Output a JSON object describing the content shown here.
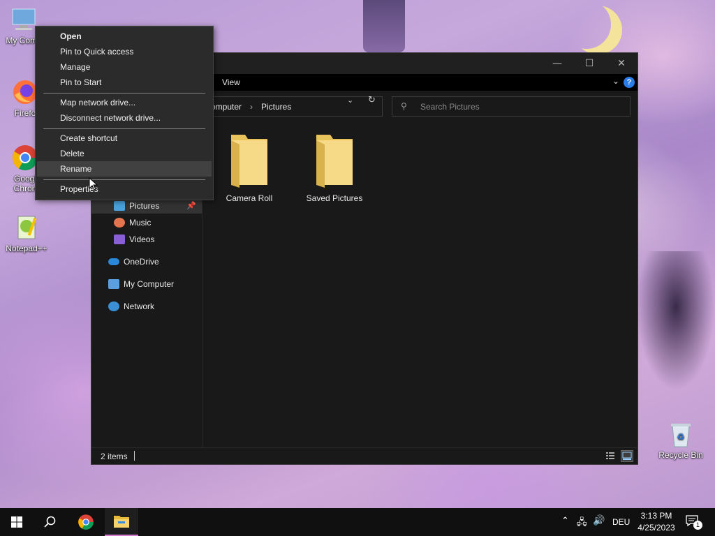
{
  "desktop": {
    "icons": [
      {
        "label": "My Comp",
        "icon": "computer-icon"
      },
      {
        "label": "Firefo",
        "icon": "firefox-icon"
      },
      {
        "label": "Googl\nChron",
        "label_line1": "Googl",
        "label_line2": "Chron",
        "icon": "chrome-icon"
      },
      {
        "label": "Notepad++",
        "icon": "notepadpp-icon"
      },
      {
        "label": "Recycle Bin",
        "icon": "recycle-bin-icon"
      }
    ]
  },
  "context_menu": {
    "items": [
      {
        "label": "Open",
        "bold": true
      },
      {
        "label": "Pin to Quick access"
      },
      {
        "label": "Manage"
      },
      {
        "label": "Pin to Start"
      },
      {
        "label": "Map network drive..."
      },
      {
        "label": "Disconnect network drive..."
      },
      {
        "label": "Create shortcut"
      },
      {
        "label": "Delete"
      },
      {
        "label": "Rename",
        "highlighted": true
      },
      {
        "label": "Properties"
      }
    ]
  },
  "explorer": {
    "ribbon": {
      "view_tab": "View"
    },
    "address": {
      "crumb1": "omputer",
      "crumb2": "Pictures"
    },
    "search": {
      "placeholder": "Search Pictures"
    },
    "nav": {
      "items": [
        {
          "label": "Pictures",
          "icon": "pictures-icon",
          "selected": true,
          "pinned": true
        },
        {
          "label": "Music",
          "icon": "music-icon"
        },
        {
          "label": "Videos",
          "icon": "videos-icon"
        },
        {
          "label": "OneDrive",
          "icon": "onedrive-icon"
        },
        {
          "label": "My Computer",
          "icon": "computer-icon"
        },
        {
          "label": "Network",
          "icon": "network-icon"
        }
      ]
    },
    "folders": [
      {
        "label": "Camera Roll"
      },
      {
        "label": "Saved Pictures"
      }
    ],
    "status": {
      "item_count": "2 items"
    }
  },
  "taskbar": {
    "language": "DEU",
    "time": "3:13 PM",
    "date": "4/25/2023",
    "notification_count": "1",
    "pinned": [
      "start-icon",
      "search-icon",
      "chrome-icon",
      "file-explorer-icon"
    ]
  },
  "colors": {
    "accent": "#d47bd0",
    "folder": "#f2d278",
    "menu_bg": "#2b2b2b",
    "explorer_bg": "#191919"
  }
}
